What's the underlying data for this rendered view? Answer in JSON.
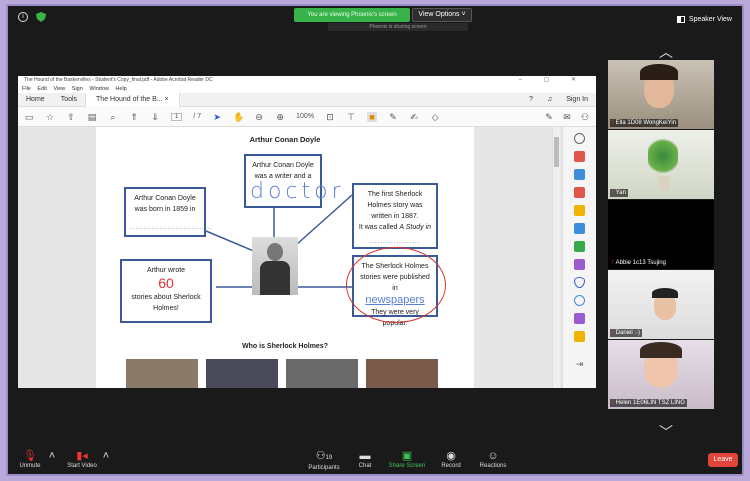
{
  "zoom": {
    "share_banner": "You are viewing Phoenix's screen",
    "share_sub": "Phoenix is sharing screen",
    "view_options": "View Options ˅",
    "speaker_view": "Speaker View",
    "participants_count": "19",
    "leave": "Leave",
    "toolbar": {
      "unmute": "Unmute",
      "start_video": "Start Video",
      "participants": "Participants",
      "chat": "Chat",
      "share_screen": "Share Screen",
      "record": "Record",
      "reactions": "Reactions"
    }
  },
  "acrobat": {
    "title": "The Hound of the Baskervilles - Student's Copy_final.pdf - Adobe Acrobat Reader DC",
    "menu": [
      "File",
      "Edit",
      "View",
      "Sign",
      "Window",
      "Help"
    ],
    "tabs": {
      "home": "Home",
      "tools": "Tools",
      "doc": "The Hound of the B...",
      "close": "×",
      "signin": "Sign In"
    },
    "page_current": "1",
    "page_total": "/ 7",
    "zoom": "100%"
  },
  "worksheet": {
    "title": "Arthur Conan Doyle",
    "box1": {
      "line1": "Arthur Conan Doyle",
      "line2": "was a writer and a"
    },
    "doctor": "doctor",
    "box2": {
      "line1": "Arthur Conan Doyle",
      "line2": "was born in 1859 in",
      "dots": "..............................."
    },
    "box3": {
      "line1": "The first Sherlock",
      "line2": "Holmes story was",
      "line3": "written in 1887.",
      "line4": "It was called",
      "italic": "A Study in",
      "dots": "..................."
    },
    "box4": {
      "line1": "Arthur wrote",
      "answer": "60",
      "line2": "stories about Sherlock",
      "line3": "Holmes!"
    },
    "box5": {
      "line1": "The Sherlock Holmes",
      "line2": "stories were published in",
      "answer": "newspapers",
      "line3": "They were very popular."
    },
    "who": "Who is Sherlock Holmes?"
  },
  "participants": [
    {
      "name": "Ella 1D08 WongKeiYin"
    },
    {
      "name": "Yan"
    },
    {
      "name": "Abbie 1c13 Tsujing"
    },
    {
      "name": "Daniel :-)"
    },
    {
      "name": "Helen 1E06LIN TSZ LING"
    }
  ]
}
